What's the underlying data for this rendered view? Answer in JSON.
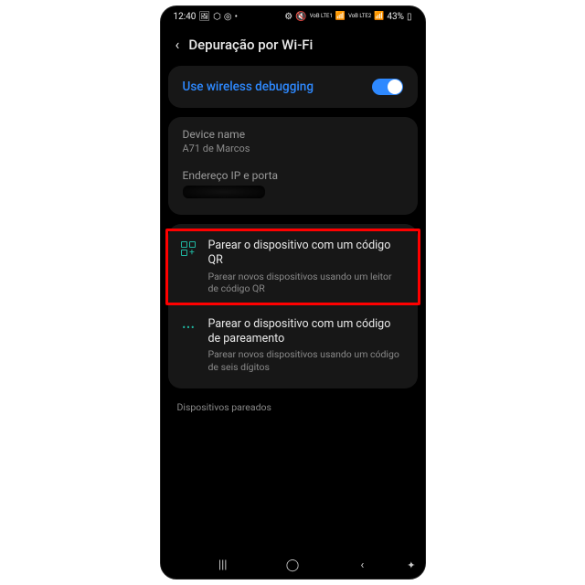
{
  "statusbar": {
    "time": "12:40",
    "icons_left": [
      "🖼",
      "⬡",
      "◎",
      "•"
    ],
    "net1": "VoB LTE1",
    "net2": "VoB LTE2",
    "battery": "43%"
  },
  "header": {
    "title": "Depuração por Wi-Fi"
  },
  "toggle": {
    "label": "Use wireless debugging",
    "on": true
  },
  "info": {
    "device_name_label": "Device name",
    "device_name_value": "A71 de Marcos",
    "ip_port_label": "Endereço IP e porta"
  },
  "options": {
    "qr": {
      "title": "Parear o dispositivo com um código QR",
      "subtitle": "Parear novos dispositivos usando um leitor de código QR"
    },
    "code": {
      "title": "Parear o dispositivo com um código de pareamento",
      "subtitle": "Parear novos dispositivos usando um código de seis dígitos"
    }
  },
  "paired_label": "Dispositivos pareados"
}
